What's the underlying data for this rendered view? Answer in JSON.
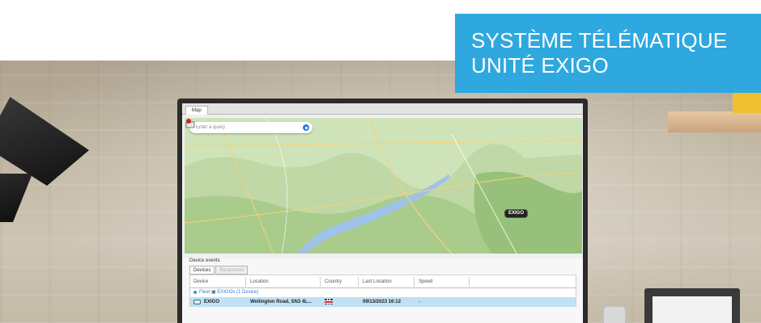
{
  "banner": {
    "line1": "SYSTÈME TÉLÉMATIQUE",
    "line2": "UNITÉ EXIGO"
  },
  "app": {
    "tabs": [
      {
        "label": "Map",
        "active": true
      }
    ],
    "search": {
      "placeholder": "Enter a query",
      "value": ""
    },
    "map": {
      "marker_label": "EXIGO",
      "colors": {
        "land": "#bfd8a6",
        "water": "#9fc2e8",
        "road": "#f5d27a"
      }
    },
    "panel": {
      "title": "Device events",
      "tabs": [
        {
          "label": "Devices",
          "active": true
        },
        {
          "label": "Responses",
          "active": false
        }
      ],
      "columns": [
        "Device",
        "Location",
        "Country",
        "Last Location",
        "Speed"
      ],
      "group": {
        "prefix": "Fleet",
        "name": "EXIGOs",
        "count_label": "(1 Device)"
      },
      "rows": [
        {
          "device": "EXIGO",
          "location": "Wellington Road, SN3 4L...",
          "country_icon": "uk-flag-icon",
          "last_location": "09/13/2023 16:12",
          "speed": "-"
        }
      ]
    }
  },
  "colors": {
    "banner": "#2fa8df",
    "row_selected": "#bfe1f3",
    "link": "#2f7fd6"
  }
}
